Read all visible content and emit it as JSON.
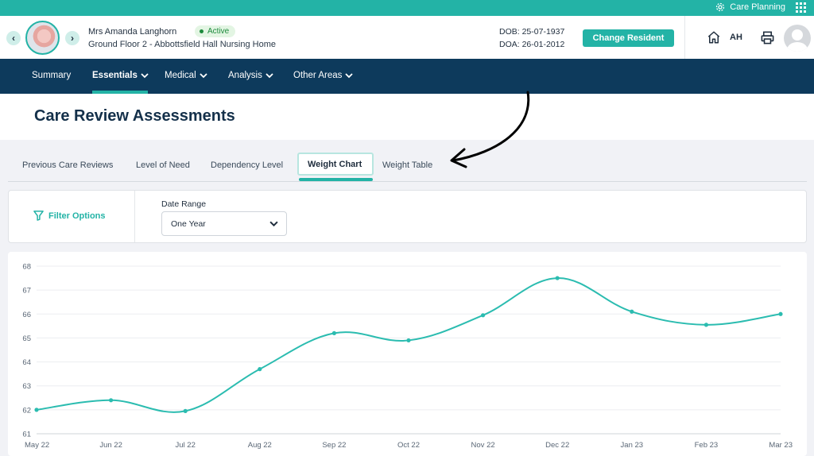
{
  "topbar": {
    "module_label": "Care Planning",
    "settings_icon": "gear-icon",
    "apps_icon": "grid-icon"
  },
  "resident": {
    "name": "Mrs Amanda Langhorn",
    "status": "Active",
    "location": "Ground Floor 2 - Abbottsfield Hall Nursing Home",
    "dob": "DOB: 25-07-1937",
    "doa": "DOA: 26-01-2012",
    "change_label": "Change Resident",
    "prev_icon": "chevron-left-icon",
    "next_icon": "chevron-right-icon"
  },
  "user": {
    "initials": "AH",
    "home_icon": "home-icon",
    "print_icon": "printer-icon"
  },
  "colors": {
    "accent": "#23b3a6",
    "nav": "#0d3a5c",
    "active_status": "#1d8a3c"
  },
  "nav": {
    "items": [
      {
        "label": "Summary"
      },
      {
        "label": "Essentials"
      },
      {
        "label": "Medical"
      },
      {
        "label": "Analysis"
      },
      {
        "label": "Other Areas"
      }
    ],
    "active": "Essentials"
  },
  "page": {
    "title": "Care Review Assessments"
  },
  "tabs": {
    "items": [
      {
        "label": "Previous Care Reviews"
      },
      {
        "label": "Level of Need"
      },
      {
        "label": "Dependency Level"
      },
      {
        "label": "Weight Chart"
      },
      {
        "label": "Weight Table"
      }
    ],
    "active": "Weight Chart"
  },
  "filter": {
    "label": "Filter Options",
    "date_range_label": "Date Range",
    "date_range_value": "One Year"
  },
  "chart_data": {
    "type": "line",
    "categories": [
      "May 22",
      "Jun 22",
      "Jul 22",
      "Aug 22",
      "Sep 22",
      "Oct 22",
      "Nov 22",
      "Dec 22",
      "Jan 23",
      "Feb 23",
      "Mar 23"
    ],
    "series": [
      {
        "values": [
          62.0,
          62.4,
          61.95,
          63.7,
          65.2,
          64.9,
          65.95,
          67.5,
          66.1,
          65.55,
          66.0
        ]
      }
    ],
    "yticks": [
      61,
      62,
      63,
      64,
      65,
      66,
      67,
      68
    ],
    "ylim": [
      61,
      68
    ],
    "grid": true,
    "line_color": "#2bbcb0"
  }
}
